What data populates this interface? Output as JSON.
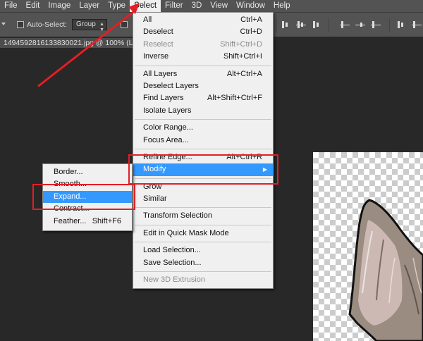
{
  "menubar": {
    "items": [
      "File",
      "Edit",
      "Image",
      "Layer",
      "Type",
      "Select",
      "Filter",
      "3D",
      "View",
      "Window",
      "Help"
    ]
  },
  "options": {
    "auto_select_label": "Auto-Select:",
    "group_value": "Group"
  },
  "document": {
    "tab_title": "1494592816133830021.jpg @ 100% (La"
  },
  "select_menu": {
    "sections": [
      [
        {
          "label": "All",
          "shortcut": "Ctrl+A",
          "disabled": false
        },
        {
          "label": "Deselect",
          "shortcut": "Ctrl+D",
          "disabled": false
        },
        {
          "label": "Reselect",
          "shortcut": "Shift+Ctrl+D",
          "disabled": true
        },
        {
          "label": "Inverse",
          "shortcut": "Shift+Ctrl+I",
          "disabled": false
        }
      ],
      [
        {
          "label": "All Layers",
          "shortcut": "Alt+Ctrl+A",
          "disabled": false
        },
        {
          "label": "Deselect Layers",
          "shortcut": "",
          "disabled": false
        },
        {
          "label": "Find Layers",
          "shortcut": "Alt+Shift+Ctrl+F",
          "disabled": false
        },
        {
          "label": "Isolate Layers",
          "shortcut": "",
          "disabled": false
        }
      ],
      [
        {
          "label": "Color Range...",
          "shortcut": "",
          "disabled": false
        },
        {
          "label": "Focus Area...",
          "shortcut": "",
          "disabled": false
        }
      ],
      [
        {
          "label": "Refine Edge...",
          "shortcut": "Alt+Ctrl+R",
          "disabled": false
        },
        {
          "label": "Modify",
          "shortcut": "",
          "disabled": false,
          "highlighted": true,
          "submenu": true
        }
      ],
      [
        {
          "label": "Grow",
          "shortcut": "",
          "disabled": false
        },
        {
          "label": "Similar",
          "shortcut": "",
          "disabled": false
        }
      ],
      [
        {
          "label": "Transform Selection",
          "shortcut": "",
          "disabled": false
        }
      ],
      [
        {
          "label": "Edit in Quick Mask Mode",
          "shortcut": "",
          "disabled": false
        }
      ],
      [
        {
          "label": "Load Selection...",
          "shortcut": "",
          "disabled": false
        },
        {
          "label": "Save Selection...",
          "shortcut": "",
          "disabled": false
        }
      ],
      [
        {
          "label": "New 3D Extrusion",
          "shortcut": "",
          "disabled": true
        }
      ]
    ]
  },
  "modify_menu": {
    "items": [
      {
        "label": "Border...",
        "shortcut": ""
      },
      {
        "label": "Smooth...",
        "shortcut": ""
      },
      {
        "label": "Expand...",
        "shortcut": "",
        "highlighted": true
      },
      {
        "label": "Contract...",
        "shortcut": ""
      },
      {
        "label": "Feather...",
        "shortcut": "Shift+F6"
      }
    ]
  },
  "colors": {
    "highlight": "#3399ff",
    "annotation": "#e31e24",
    "menubar": "#535353",
    "workspace": "#282828"
  }
}
